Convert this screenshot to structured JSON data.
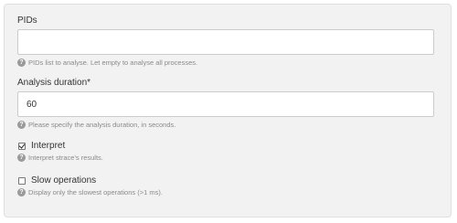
{
  "form": {
    "pids": {
      "label": "PIDs",
      "value": "",
      "help": "PIDs list to analyse. Let empty to analyse all processes."
    },
    "analysis_duration": {
      "label": "Analysis duration*",
      "value": "60",
      "help": "Please specify the analysis duration, in seconds."
    },
    "interpret": {
      "label": "Interpret",
      "checked": true,
      "help": "Interpret strace's results."
    },
    "slow_operations": {
      "label": "Slow operations",
      "checked": false,
      "help": "Display only the slowest operations (>1 ms)."
    },
    "help_icon_glyph": "?"
  }
}
